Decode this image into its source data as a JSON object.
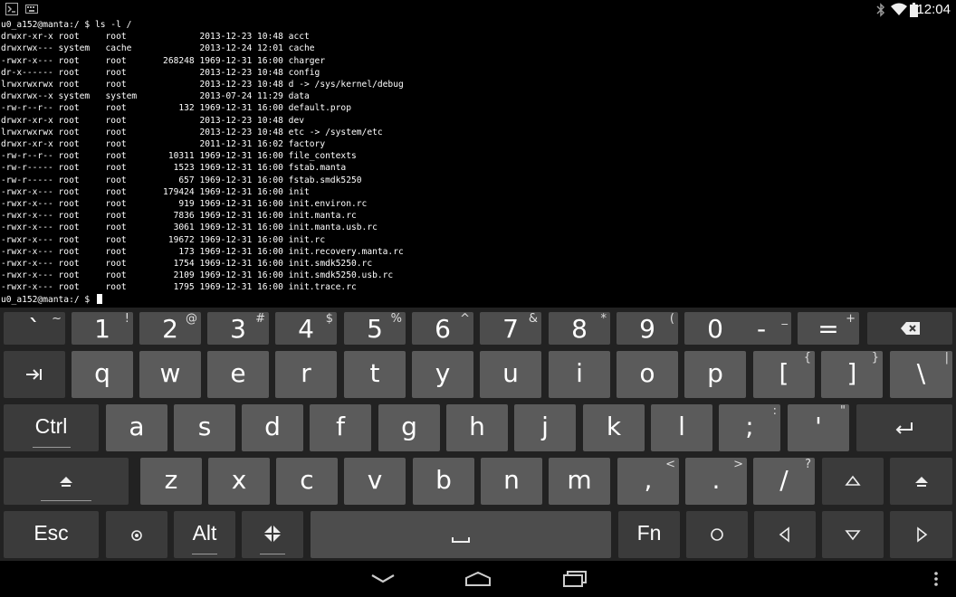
{
  "status_bar": {
    "clock": "12:04",
    "icons": [
      "terminal-notification-icon",
      "keyboard-notification-icon",
      "bluetooth-icon",
      "wifi-icon",
      "battery-icon"
    ]
  },
  "terminal": {
    "lines": [
      "u0_a152@manta:/ $ ls -l /",
      "drwxr-xr-x root     root              2013-12-23 10:48 acct",
      "drwxrwx--- system   cache             2013-12-24 12:01 cache",
      "-rwxr-x--- root     root       268248 1969-12-31 16:00 charger",
      "dr-x------ root     root              2013-12-23 10:48 config",
      "lrwxrwxrwx root     root              2013-12-23 10:48 d -> /sys/kernel/debug",
      "drwxrwx--x system   system            2013-07-24 11:29 data",
      "-rw-r--r-- root     root          132 1969-12-31 16:00 default.prop",
      "drwxr-xr-x root     root              2013-12-23 10:48 dev",
      "lrwxrwxrwx root     root              2013-12-23 10:48 etc -> /system/etc",
      "drwxr-xr-x root     root              2011-12-31 16:02 factory",
      "-rw-r--r-- root     root        10311 1969-12-31 16:00 file_contexts",
      "-rw-r----- root     root         1523 1969-12-31 16:00 fstab.manta",
      "-rw-r----- root     root          657 1969-12-31 16:00 fstab.smdk5250",
      "-rwxr-x--- root     root       179424 1969-12-31 16:00 init",
      "-rwxr-x--- root     root          919 1969-12-31 16:00 init.environ.rc",
      "-rwxr-x--- root     root         7836 1969-12-31 16:00 init.manta.rc",
      "-rwxr-x--- root     root         3061 1969-12-31 16:00 init.manta.usb.rc",
      "-rwxr-x--- root     root        19672 1969-12-31 16:00 init.rc",
      "-rwxr-x--- root     root          173 1969-12-31 16:00 init.recovery.manta.rc",
      "-rwxr-x--- root     root         1754 1969-12-31 16:00 init.smdk5250.rc",
      "-rwxr-x--- root     root         2109 1969-12-31 16:00 init.smdk5250.usb.rc",
      "-rwxr-x--- root     root         1795 1969-12-31 16:00 init.trace.rc"
    ],
    "prompt": "u0_a152@manta:/ $ "
  },
  "keyboard": {
    "rows": [
      [
        {
          "name": "key-backtick",
          "label": "`",
          "alt": "~",
          "shade": "dark"
        },
        {
          "name": "key-1",
          "label": "1",
          "alt": "!",
          "shade": "mid"
        },
        {
          "name": "key-2",
          "label": "2",
          "alt": "@",
          "shade": "mid"
        },
        {
          "name": "key-3",
          "label": "3",
          "alt": "#",
          "shade": "mid"
        },
        {
          "name": "key-4",
          "label": "4",
          "alt": "$",
          "shade": "mid"
        },
        {
          "name": "key-5",
          "label": "5",
          "alt": "%",
          "shade": "mid"
        },
        {
          "name": "key-6",
          "label": "6",
          "alt": "^",
          "shade": "mid"
        },
        {
          "name": "key-7",
          "label": "7",
          "alt": "&",
          "shade": "mid"
        },
        {
          "name": "key-8",
          "label": "8",
          "alt": "*",
          "shade": "mid"
        },
        {
          "name": "key-9",
          "label": "9",
          "alt": "(",
          "shade": "mid"
        },
        {
          "name": "key-0",
          "label": "0",
          "alt": ")",
          "shade": "mid"
        },
        {
          "name": "key-minus",
          "label": "-",
          "alt": "_",
          "shade": "mid"
        },
        {
          "name": "key-equals",
          "label": "=",
          "alt": "+",
          "shade": "mid"
        },
        {
          "name": "key-backspace",
          "label": "",
          "alt": "",
          "icon": "backspace-icon",
          "shade": "dark"
        }
      ],
      [
        {
          "name": "key-tab",
          "label": "",
          "alt": "",
          "icon": "tab-icon",
          "shade": "dark"
        },
        {
          "name": "key-q",
          "label": "q",
          "alt": "",
          "shade": "light"
        },
        {
          "name": "key-w",
          "label": "w",
          "alt": "",
          "shade": "light"
        },
        {
          "name": "key-e",
          "label": "e",
          "alt": "",
          "shade": "light"
        },
        {
          "name": "key-r",
          "label": "r",
          "alt": "",
          "shade": "light"
        },
        {
          "name": "key-t",
          "label": "t",
          "alt": "",
          "shade": "light"
        },
        {
          "name": "key-y",
          "label": "y",
          "alt": "",
          "shade": "light"
        },
        {
          "name": "key-u",
          "label": "u",
          "alt": "",
          "shade": "light"
        },
        {
          "name": "key-i",
          "label": "i",
          "alt": "",
          "shade": "light"
        },
        {
          "name": "key-o",
          "label": "o",
          "alt": "",
          "shade": "light"
        },
        {
          "name": "key-p",
          "label": "p",
          "alt": "",
          "shade": "light"
        },
        {
          "name": "key-left-bracket",
          "label": "[",
          "alt": "{",
          "shade": "light"
        },
        {
          "name": "key-right-bracket",
          "label": "]",
          "alt": "}",
          "shade": "light"
        },
        {
          "name": "key-backslash",
          "label": "\\",
          "alt": "|",
          "shade": "light"
        }
      ],
      [
        {
          "name": "key-ctrl",
          "label": "Ctrl",
          "alt": "",
          "shade": "dark",
          "word": true,
          "underline": true
        },
        {
          "name": "key-a",
          "label": "a",
          "alt": "",
          "shade": "light"
        },
        {
          "name": "key-s",
          "label": "s",
          "alt": "",
          "shade": "light"
        },
        {
          "name": "key-d",
          "label": "d",
          "alt": "",
          "shade": "light"
        },
        {
          "name": "key-f",
          "label": "f",
          "alt": "",
          "shade": "light"
        },
        {
          "name": "key-g",
          "label": "g",
          "alt": "",
          "shade": "light"
        },
        {
          "name": "key-h",
          "label": "h",
          "alt": "",
          "shade": "light"
        },
        {
          "name": "key-j",
          "label": "j",
          "alt": "",
          "shade": "light"
        },
        {
          "name": "key-k",
          "label": "k",
          "alt": "",
          "shade": "light"
        },
        {
          "name": "key-l",
          "label": "l",
          "alt": "",
          "shade": "light"
        },
        {
          "name": "key-semicolon",
          "label": ";",
          "alt": ":",
          "shade": "light"
        },
        {
          "name": "key-quote",
          "label": "'",
          "alt": "\"",
          "shade": "light"
        },
        {
          "name": "key-enter",
          "label": "",
          "alt": "",
          "icon": "enter-icon",
          "shade": "dark"
        }
      ],
      [
        {
          "name": "key-shift-left",
          "label": "",
          "alt": "",
          "icon": "shift-icon",
          "shade": "dark",
          "underline": true
        },
        {
          "name": "key-z",
          "label": "z",
          "alt": "",
          "shade": "light"
        },
        {
          "name": "key-x",
          "label": "x",
          "alt": "",
          "shade": "light"
        },
        {
          "name": "key-c",
          "label": "c",
          "alt": "",
          "shade": "light"
        },
        {
          "name": "key-v",
          "label": "v",
          "alt": "",
          "shade": "light"
        },
        {
          "name": "key-b",
          "label": "b",
          "alt": "",
          "shade": "light"
        },
        {
          "name": "key-n",
          "label": "n",
          "alt": "",
          "shade": "light"
        },
        {
          "name": "key-m",
          "label": "m",
          "alt": "",
          "shade": "light"
        },
        {
          "name": "key-comma",
          "label": ",",
          "alt": "<",
          "shade": "light"
        },
        {
          "name": "key-period",
          "label": ".",
          "alt": ">",
          "shade": "light"
        },
        {
          "name": "key-slash",
          "label": "/",
          "alt": "?",
          "shade": "light"
        },
        {
          "name": "key-arrow-up",
          "label": "",
          "alt": "",
          "icon": "arrow-up-icon",
          "shade": "dark"
        },
        {
          "name": "key-shift-right",
          "label": "",
          "alt": "",
          "icon": "shift-icon",
          "shade": "dark"
        }
      ],
      [
        {
          "name": "key-esc",
          "label": "Esc",
          "alt": "",
          "shade": "dark",
          "word": true
        },
        {
          "name": "key-settings",
          "label": "",
          "alt": "",
          "icon": "settings-dot-icon",
          "shade": "dark"
        },
        {
          "name": "key-alt",
          "label": "Alt",
          "alt": "",
          "shade": "dark",
          "word": true,
          "underline": true
        },
        {
          "name": "key-meta",
          "label": "",
          "alt": "",
          "icon": "diamond-icon",
          "shade": "dark",
          "underline": true
        },
        {
          "name": "key-space",
          "label": "",
          "alt": "",
          "icon": "space-icon",
          "shade": "mid"
        },
        {
          "name": "key-fn",
          "label": "Fn",
          "alt": "",
          "shade": "dark",
          "word": true
        },
        {
          "name": "key-circle",
          "label": "",
          "alt": "",
          "icon": "circle-icon",
          "shade": "dark"
        },
        {
          "name": "key-arrow-left",
          "label": "",
          "alt": "",
          "icon": "arrow-left-icon",
          "shade": "dark"
        },
        {
          "name": "key-arrow-down",
          "label": "",
          "alt": "",
          "icon": "arrow-down-icon",
          "shade": "dark"
        },
        {
          "name": "key-arrow-right",
          "label": "",
          "alt": "",
          "icon": "arrow-right-icon",
          "shade": "dark"
        }
      ]
    ]
  },
  "nav_bar": {
    "icons": [
      "back-icon",
      "home-icon",
      "recents-icon",
      "menu-icon"
    ]
  }
}
